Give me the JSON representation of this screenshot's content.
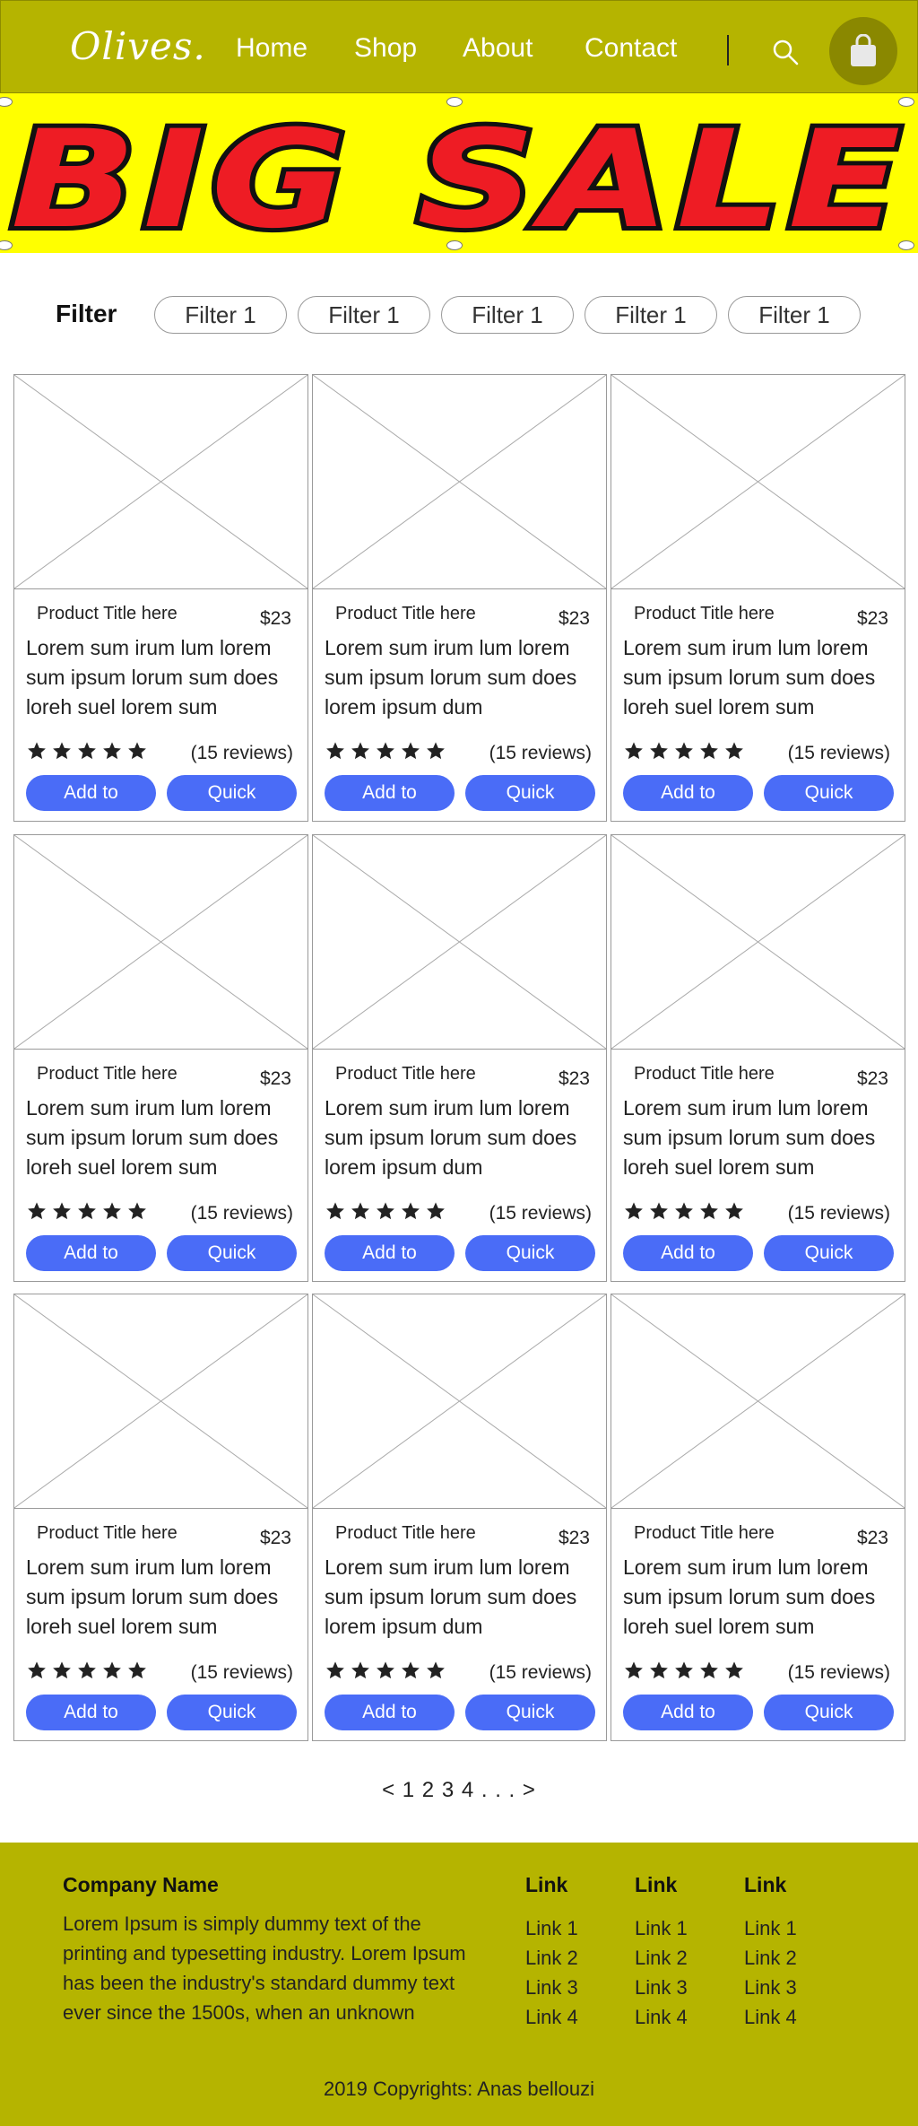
{
  "header": {
    "logo": "Olives.",
    "nav": [
      "Home",
      "Shop",
      "About",
      "Contact"
    ],
    "search_icon": "search-icon",
    "cart_icon": "shopping-bag-icon",
    "colors": {
      "header_bg": "#b5b400",
      "cart_circle": "#8a8800"
    }
  },
  "banner": {
    "text": "BIG SALE",
    "colors": {
      "background": "#ffff00",
      "letters": "#ee1c24",
      "outline": "#111111"
    }
  },
  "filter": {
    "label": "Filter",
    "options": [
      "Filter 1",
      "Filter 1",
      "Filter 1",
      "Filter 1",
      "Filter 1"
    ]
  },
  "products": [
    {
      "title": "Product Title here",
      "price": "$23",
      "desc": "Lorem sum irum lum lorem sum ipsum lorum sum does loreh suel lorem sum",
      "rating": 5,
      "reviews": "(15 reviews)",
      "add_label": "Add to",
      "quick_label": "Quick"
    },
    {
      "title": "Product Title here",
      "price": "$23",
      "desc": "Lorem sum irum lum lorem sum ipsum lorum sum does lorem ipsum dum",
      "rating": 5,
      "reviews": "(15 reviews)",
      "add_label": "Add to",
      "quick_label": "Quick"
    },
    {
      "title": "Product Title here",
      "price": "$23",
      "desc": "Lorem sum irum lum lorem sum ipsum lorum sum does loreh suel lorem sum",
      "rating": 5,
      "reviews": "(15 reviews)",
      "add_label": "Add to",
      "quick_label": "Quick"
    },
    {
      "title": "Product Title here",
      "price": "$23",
      "desc": "Lorem sum irum lum lorem sum ipsum lorum sum does loreh suel lorem sum",
      "rating": 5,
      "reviews": "(15 reviews)",
      "add_label": "Add to",
      "quick_label": "Quick"
    },
    {
      "title": "Product Title here",
      "price": "$23",
      "desc": "Lorem sum irum lum lorem sum ipsum lorum sum does lorem ipsum dum",
      "rating": 5,
      "reviews": "(15 reviews)",
      "add_label": "Add to",
      "quick_label": "Quick"
    },
    {
      "title": "Product Title here",
      "price": "$23",
      "desc": "Lorem sum irum lum lorem sum ipsum lorum sum does loreh suel lorem sum",
      "rating": 5,
      "reviews": "(15 reviews)",
      "add_label": "Add to",
      "quick_label": "Quick"
    },
    {
      "title": "Product Title here",
      "price": "$23",
      "desc": "Lorem sum irum lum lorem sum ipsum lorum sum does loreh suel lorem sum",
      "rating": 5,
      "reviews": "(15 reviews)",
      "add_label": "Add to",
      "quick_label": "Quick"
    },
    {
      "title": "Product Title here",
      "price": "$23",
      "desc": "Lorem sum irum lum lorem sum ipsum lorum sum does lorem ipsum dum",
      "rating": 5,
      "reviews": "(15 reviews)",
      "add_label": "Add to",
      "quick_label": "Quick"
    },
    {
      "title": "Product Title here",
      "price": "$23",
      "desc": "Lorem sum irum lum lorem sum ipsum lorum sum does loreh suel lorem sum",
      "rating": 5,
      "reviews": "(15 reviews)",
      "add_label": "Add to",
      "quick_label": "Quick"
    }
  ],
  "button_color": "#4a6cf7",
  "pagination": "< 1 2 3 4 . . . >",
  "footer": {
    "company": "Company Name",
    "text": "Lorem Ipsum is simply dummy text of the printing and typesetting industry. Lorem Ipsum has been the industry's standard dummy text ever since the 1500s, when an unknown",
    "columns": [
      {
        "heading": "Link",
        "links": [
          "Link 1",
          "Link 2",
          "Link 3",
          "Link 4"
        ]
      },
      {
        "heading": "Link",
        "links": [
          "Link 1",
          "Link 2",
          "Link 3",
          "Link 4"
        ]
      },
      {
        "heading": "Link",
        "links": [
          "Link 1",
          "Link 2",
          "Link 3",
          "Link 4"
        ]
      }
    ],
    "copyright": "2019 Copyrights: Anas bellouzi"
  }
}
